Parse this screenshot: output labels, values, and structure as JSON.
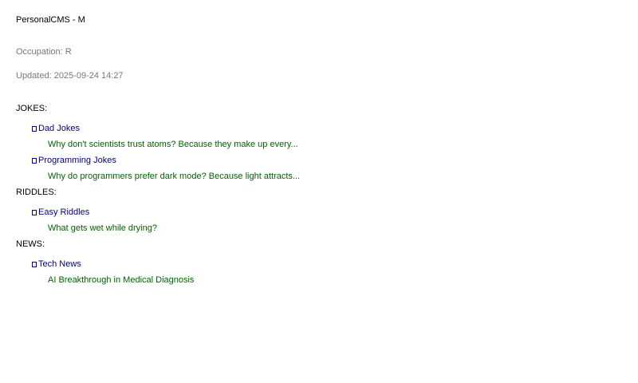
{
  "app": {
    "title": "PersonalCMS - M"
  },
  "profile": {
    "occupation": "Occupation: R",
    "updated": "Updated: 2025-09-24 14:27"
  },
  "sections": [
    {
      "header": "JOKES:",
      "categories": [
        {
          "icon": "folder-icon",
          "label": "Dad Jokes",
          "items": [
            "Why don't scientists trust atoms? Because they make up every..."
          ]
        },
        {
          "icon": "folder-icon",
          "label": "Programming Jokes",
          "items": [
            "Why do programmers prefer dark mode? Because light attracts..."
          ]
        }
      ]
    },
    {
      "header": "RIDDLES:",
      "categories": [
        {
          "icon": "folder-icon",
          "label": "Easy Riddles",
          "items": [
            "What gets wet while drying?"
          ]
        }
      ]
    },
    {
      "header": "NEWS:",
      "categories": [
        {
          "icon": "folder-icon",
          "label": "Tech News",
          "items": [
            "AI Breakthrough in Medical Diagnosis"
          ]
        }
      ]
    }
  ],
  "colors": {
    "category": "#000080",
    "item": "#006400",
    "meta": "#777777",
    "text": "#000000"
  }
}
